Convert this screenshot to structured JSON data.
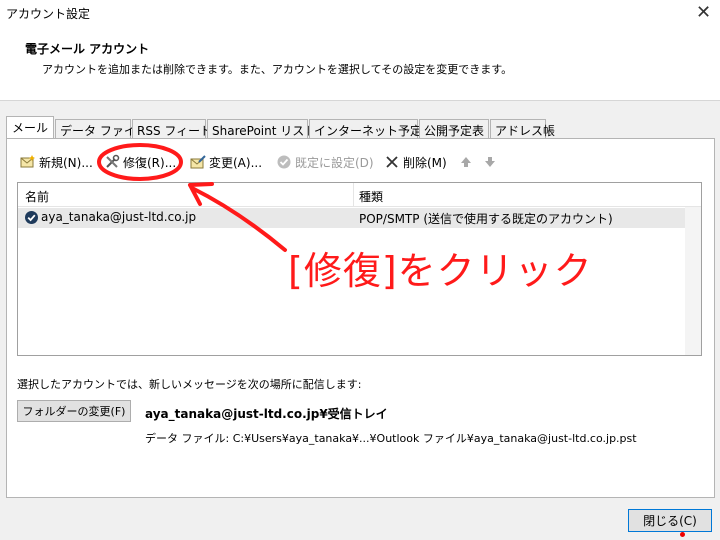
{
  "window": {
    "title": "アカウント設定"
  },
  "header": {
    "title": "電子メール アカウント",
    "subtitle": "アカウントを追加または削除できます。また、アカウントを選択してその設定を変更できます。"
  },
  "tabs": [
    {
      "label": "メール",
      "active": true
    },
    {
      "label": "データ ファイル"
    },
    {
      "label": "RSS フィード"
    },
    {
      "label": "SharePoint リスト"
    },
    {
      "label": "インターネット予定表"
    },
    {
      "label": "公開予定表"
    },
    {
      "label": "アドレス帳"
    }
  ],
  "toolbar": {
    "new_label": "新規(N)...",
    "repair_label": "修復(R)...",
    "change_label": "変更(A)...",
    "default_label": "既定に設定(D)",
    "delete_label": "削除(M)",
    "new_icon": "new-mail-icon",
    "repair_icon": "tools-icon",
    "change_icon": "change-icon",
    "default_icon": "check-circle-icon",
    "delete_icon": "x-icon",
    "up_icon": "arrow-up-icon",
    "down_icon": "arrow-down-icon"
  },
  "accounts": {
    "columns": [
      "名前",
      "種類"
    ],
    "rows": [
      {
        "name": "aya_tanaka@just-ltd.co.jp",
        "type": "POP/SMTP (送信で使用する既定のアカウント)"
      }
    ]
  },
  "delivery": {
    "label": "選択したアカウントでは、新しいメッセージを次の場所に配信します:",
    "folder_button": "フォルダーの変更(F)",
    "folder": "aya_tanaka@just-ltd.co.jp¥受信トレイ",
    "data_file": "データ ファイル: C:¥Users¥aya_tanaka¥...¥Outlook ファイル¥aya_tanaka@just-ltd.co.jp.pst"
  },
  "footer": {
    "close_label": "閉じる(C)"
  },
  "annotation": {
    "text": "[修復]をクリック",
    "color": "#ff1a1a"
  },
  "colors": {
    "selection_row": "#e8e8e8",
    "focus_border": "#0078d7"
  }
}
